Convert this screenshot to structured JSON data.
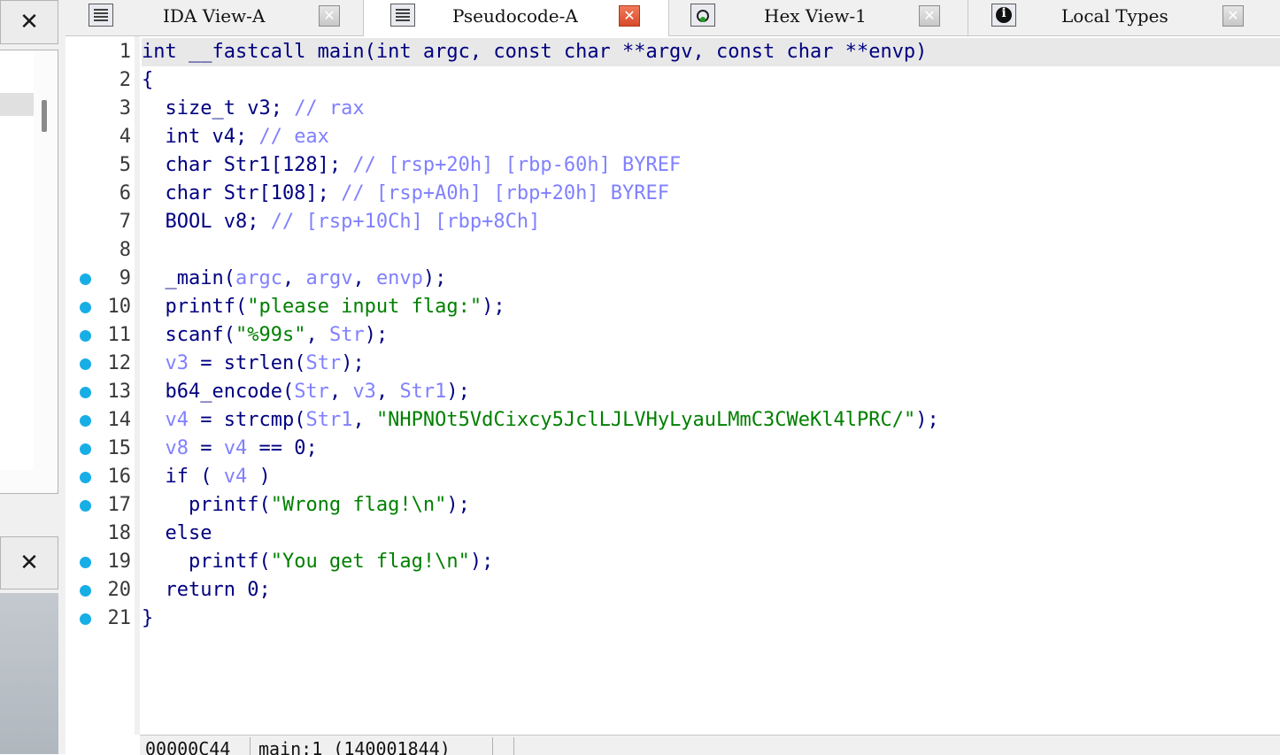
{
  "tabs": [
    {
      "label": "IDA View-A",
      "icon": "list-icon",
      "active": false
    },
    {
      "label": "Pseudocode-A",
      "icon": "list-icon",
      "active": true
    },
    {
      "label": "Hex View-1",
      "icon": "hex-icon",
      "active": false
    },
    {
      "label": "Local Types",
      "icon": "info-icon",
      "active": false
    }
  ],
  "left_panel": {
    "close_glyph": "✕"
  },
  "tab_close_glyph": "✕",
  "editor": {
    "lines": [
      {
        "n": "1",
        "bp": false,
        "tokens": [
          [
            "def",
            "int __fastcall main(int argc, const char **argv, const char **envp)"
          ]
        ]
      },
      {
        "n": "2",
        "bp": false,
        "tokens": [
          [
            "def",
            "{"
          ]
        ]
      },
      {
        "n": "3",
        "bp": false,
        "tokens": [
          [
            "def",
            "  size_t v3; "
          ],
          [
            "cmt",
            "// rax"
          ]
        ]
      },
      {
        "n": "4",
        "bp": false,
        "tokens": [
          [
            "def",
            "  int v4; "
          ],
          [
            "cmt",
            "// eax"
          ]
        ]
      },
      {
        "n": "5",
        "bp": false,
        "tokens": [
          [
            "def",
            "  char Str1[128]; "
          ],
          [
            "cmt",
            "// [rsp+20h] [rbp-60h] BYREF"
          ]
        ]
      },
      {
        "n": "6",
        "bp": false,
        "tokens": [
          [
            "def",
            "  char Str[108]; "
          ],
          [
            "cmt",
            "// [rsp+A0h] [rbp+20h] BYREF"
          ]
        ]
      },
      {
        "n": "7",
        "bp": false,
        "tokens": [
          [
            "def",
            "  BOOL v8; "
          ],
          [
            "cmt",
            "// [rsp+10Ch] [rbp+8Ch]"
          ]
        ]
      },
      {
        "n": "8",
        "bp": false,
        "tokens": [
          [
            "def",
            ""
          ]
        ]
      },
      {
        "n": "9",
        "bp": true,
        "tokens": [
          [
            "def",
            "  _main("
          ],
          [
            "var",
            "argc"
          ],
          [
            "def",
            ", "
          ],
          [
            "var",
            "argv"
          ],
          [
            "def",
            ", "
          ],
          [
            "var",
            "envp"
          ],
          [
            "def",
            ");"
          ]
        ]
      },
      {
        "n": "10",
        "bp": true,
        "tokens": [
          [
            "def",
            "  printf("
          ],
          [
            "str",
            "\"please input flag:\""
          ],
          [
            "def",
            ");"
          ]
        ]
      },
      {
        "n": "11",
        "bp": true,
        "tokens": [
          [
            "def",
            "  scanf("
          ],
          [
            "str",
            "\"%99s\""
          ],
          [
            "def",
            ", "
          ],
          [
            "var",
            "Str"
          ],
          [
            "def",
            ");"
          ]
        ]
      },
      {
        "n": "12",
        "bp": true,
        "tokens": [
          [
            "def",
            "  "
          ],
          [
            "var",
            "v3"
          ],
          [
            "def",
            " = strlen("
          ],
          [
            "var",
            "Str"
          ],
          [
            "def",
            ");"
          ]
        ]
      },
      {
        "n": "13",
        "bp": true,
        "tokens": [
          [
            "def",
            "  b64_encode("
          ],
          [
            "var",
            "Str"
          ],
          [
            "def",
            ", "
          ],
          [
            "var",
            "v3"
          ],
          [
            "def",
            ", "
          ],
          [
            "var",
            "Str1"
          ],
          [
            "def",
            ");"
          ]
        ]
      },
      {
        "n": "14",
        "bp": true,
        "tokens": [
          [
            "def",
            "  "
          ],
          [
            "var",
            "v4"
          ],
          [
            "def",
            " = strcmp("
          ],
          [
            "var",
            "Str1"
          ],
          [
            "def",
            ", "
          ],
          [
            "str",
            "\"NHPNOt5VdCixcy5JclLJLVHyLyauLMmC3CWeKl4lPRC/\""
          ],
          [
            "def",
            ");"
          ]
        ]
      },
      {
        "n": "15",
        "bp": true,
        "tokens": [
          [
            "def",
            "  "
          ],
          [
            "var",
            "v8"
          ],
          [
            "def",
            " = "
          ],
          [
            "var",
            "v4"
          ],
          [
            "def",
            " == 0;"
          ]
        ]
      },
      {
        "n": "16",
        "bp": true,
        "tokens": [
          [
            "def",
            "  if ( "
          ],
          [
            "var",
            "v4"
          ],
          [
            "def",
            " )"
          ]
        ]
      },
      {
        "n": "17",
        "bp": true,
        "tokens": [
          [
            "def",
            "    printf("
          ],
          [
            "str",
            "\"Wrong flag!\\n\""
          ],
          [
            "def",
            ");"
          ]
        ]
      },
      {
        "n": "18",
        "bp": false,
        "tokens": [
          [
            "def",
            "  else"
          ]
        ]
      },
      {
        "n": "19",
        "bp": true,
        "tokens": [
          [
            "def",
            "    printf("
          ],
          [
            "str",
            "\"You get flag!\\n\""
          ],
          [
            "def",
            ");"
          ]
        ]
      },
      {
        "n": "20",
        "bp": true,
        "tokens": [
          [
            "def",
            "  return 0;"
          ]
        ]
      },
      {
        "n": "21",
        "bp": true,
        "tokens": [
          [
            "def",
            "}"
          ]
        ]
      }
    ]
  },
  "status": {
    "address": "00000C44",
    "location": "main:1 (140001844)"
  },
  "colors": {
    "keyword": "#000080",
    "comment": "#8080ff",
    "variable": "#8080ff",
    "string": "#008000",
    "breakpoint_dot": "#17aee6",
    "active_tab_close": "#e05a3a"
  }
}
